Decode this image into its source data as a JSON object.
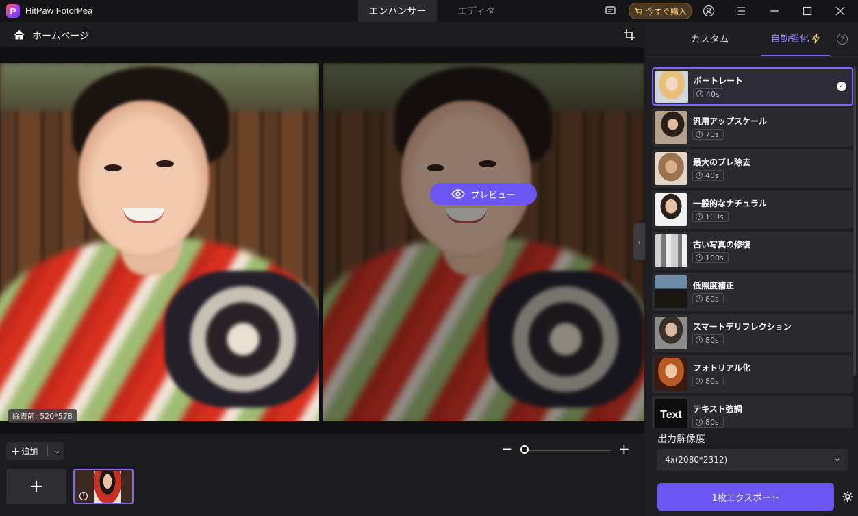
{
  "app": {
    "title": "HitPaw FotorPea",
    "logo_letter": "P"
  },
  "tabs": [
    {
      "label": "エンハンサー",
      "active": true
    },
    {
      "label": "エディタ",
      "active": false
    }
  ],
  "titlebar": {
    "buy_label": "今すぐ購入"
  },
  "subbar": {
    "home_label": "ホームページ"
  },
  "canvas": {
    "size_label": "除去前: 520*578",
    "preview_label": "プレビュー"
  },
  "bottom": {
    "add_label": "追加",
    "zoom_level": 0
  },
  "panel": {
    "tab_custom": "カスタム",
    "tab_auto": "自動強化",
    "models": [
      {
        "name": "ポートレート",
        "duration": "40s",
        "selected": true
      },
      {
        "name": "汎用アップスケール",
        "duration": "70s",
        "selected": false
      },
      {
        "name": "最大のブレ除去",
        "duration": "40s",
        "selected": false
      },
      {
        "name": "一般的なナチュラル",
        "duration": "100s",
        "selected": false
      },
      {
        "name": "古い写真の修復",
        "duration": "100s",
        "selected": false
      },
      {
        "name": "低照度補正",
        "duration": "80s",
        "selected": false
      },
      {
        "name": "スマートデリフレクション",
        "duration": "80s",
        "selected": false
      },
      {
        "name": "フォトリアル化",
        "duration": "80s",
        "selected": false
      },
      {
        "name": "テキスト強調",
        "duration": "80s",
        "selected": false
      }
    ],
    "output_label": "出力解像度",
    "output_value": "4x(2080*2312)",
    "export_label": "1枚エクスポート",
    "text_thumb_label": "Text"
  },
  "colors": {
    "accent": "#6b56f4",
    "buy_text": "#f4c874"
  }
}
